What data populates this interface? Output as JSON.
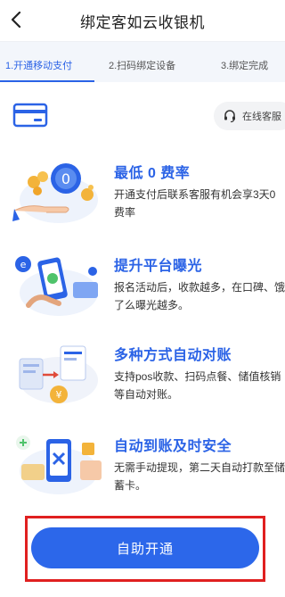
{
  "header": {
    "title": "绑定客如云收银机"
  },
  "steps": [
    {
      "label": "1.开通移动支付"
    },
    {
      "label": "2.扫码绑定设备"
    },
    {
      "label": "3.绑定完成"
    }
  ],
  "service": {
    "label": "在线客服"
  },
  "features": [
    {
      "title": "最低 0 费率",
      "desc": "开通支付后联系客服有机会享3天0费率"
    },
    {
      "title": "提升平台曝光",
      "desc": "报名活动后，收款越多，在口碑、饿了么曝光越多。"
    },
    {
      "title": "多种方式自动对账",
      "desc": "支持pos收款、扫码点餐、储值核销等自动对账。"
    },
    {
      "title": "自动到账及时安全",
      "desc": "无需手动提现，第二天自动打款至储蓄卡。"
    }
  ],
  "cta": {
    "label": "自助开通"
  },
  "colors": {
    "accent": "#2b63e6",
    "highlight_border": "#e02020"
  }
}
